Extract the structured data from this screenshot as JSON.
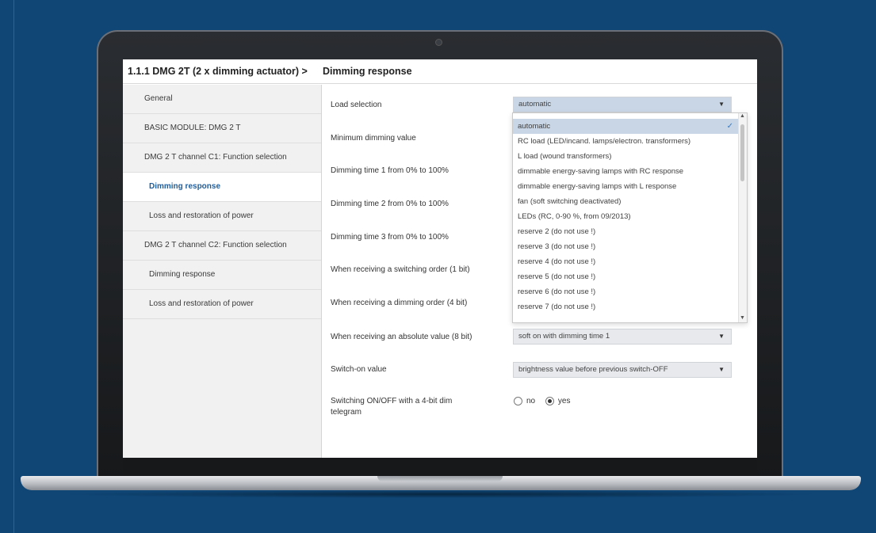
{
  "breadcrumb": {
    "device": "1.1.1 DMG 2T (2 x dimming actuator) >",
    "page": "Dimming response"
  },
  "sidebar": {
    "items": [
      {
        "label": "General"
      },
      {
        "label": "BASIC MODULE: DMG 2 T"
      },
      {
        "label": "DMG 2 T channel C1: Function selection"
      },
      {
        "label": "Dimming response",
        "active": true
      },
      {
        "label": "Loss and restoration of power"
      },
      {
        "label": "DMG 2 T channel C2: Function selection"
      },
      {
        "label": "Dimming response"
      },
      {
        "label": "Loss and restoration of power"
      }
    ]
  },
  "params": {
    "load_selection": "Load selection",
    "min_dimming": "Minimum dimming value",
    "dim_time_1": "Dimming time 1 from 0% to 100%",
    "dim_time_2": "Dimming time 2 from 0% to 100%",
    "dim_time_3": "Dimming time 3 from 0% to 100%",
    "switching_order": "When receiving a switching order (1 bit)",
    "dimming_order": "When receiving a dimming order (4 bit)",
    "absolute_value": "When receiving an absolute value (8 bit)",
    "switch_on_value": "Switch-on value",
    "switching_4bit": "Switching ON/OFF with a 4-bit dim telegram"
  },
  "values": {
    "load_selection": "automatic",
    "absolute_value": "soft on with dimming time 1",
    "switch_on_value": "brightness value before previous switch-OFF"
  },
  "dropdown": {
    "options": [
      "automatic",
      "RC load (LED/incand. lamps/electron. transformers)",
      "L load (wound transformers)",
      "dimmable energy-saving lamps with RC response",
      "dimmable energy-saving lamps with L response",
      "fan (soft switching deactivated)",
      "LEDs (RC, 0-90 %, from 09/2013)",
      "reserve 2 (do not use !)",
      "reserve 3 (do not use !)",
      "reserve 4 (do not use !)",
      "reserve 5 (do not use !)",
      "reserve 6 (do not use !)",
      "reserve 7 (do not use !)"
    ],
    "selected": "automatic"
  },
  "radio": {
    "no": "no",
    "yes": "yes",
    "selected": "yes"
  },
  "icons": {
    "dropdown": "chevron-down-icon",
    "selected_check": "check-icon",
    "scroll_up": "scroll-up-arrow-icon",
    "scroll_down": "scroll-down-arrow-icon"
  },
  "colors": {
    "background": "#0f4676",
    "active_nav": "#1f5e9c",
    "selection": "#c8d6e6"
  }
}
